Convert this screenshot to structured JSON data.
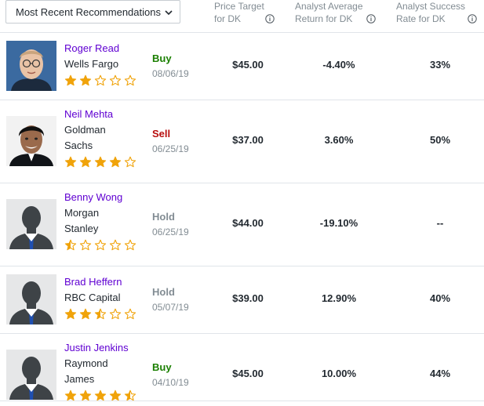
{
  "filter": {
    "selected": "Most Recent Recommendations"
  },
  "columns": {
    "price_target": [
      "Price Target",
      "for DK"
    ],
    "avg_return": [
      "Analyst Average",
      "Return for DK"
    ],
    "success_rate": [
      "Analyst Success",
      "Rate for DK"
    ]
  },
  "colors": {
    "buy": "#1a7f00",
    "sell": "#b80e0e",
    "hold": "#828c93",
    "star": "#f0a30a",
    "link": "#6001d2"
  },
  "analysts": [
    {
      "name": "Roger Read",
      "firm": [
        "Wells Fargo"
      ],
      "stars": 2,
      "rating": "Buy",
      "rating_type": "buy",
      "date": "08/06/19",
      "price_target": "$45.00",
      "avg_return": "-4.40%",
      "success_rate": "33%",
      "avatar": "photo-roger-read"
    },
    {
      "name": "Neil Mehta",
      "firm": [
        "Goldman",
        "Sachs"
      ],
      "stars": 4,
      "rating": "Sell",
      "rating_type": "sell",
      "date": "06/25/19",
      "price_target": "$37.00",
      "avg_return": "3.60%",
      "success_rate": "50%",
      "avatar": "photo-neil-mehta"
    },
    {
      "name": "Benny Wong",
      "firm": [
        "Morgan",
        "Stanley"
      ],
      "stars": 0.5,
      "rating": "Hold",
      "rating_type": "hold",
      "date": "06/25/19",
      "price_target": "$44.00",
      "avg_return": "-19.10%",
      "success_rate": "--",
      "avatar": "silhouette"
    },
    {
      "name": "Brad Heffern",
      "firm": [
        "RBC Capital"
      ],
      "stars": 2.5,
      "rating": "Hold",
      "rating_type": "hold",
      "date": "05/07/19",
      "price_target": "$39.00",
      "avg_return": "12.90%",
      "success_rate": "40%",
      "avatar": "silhouette"
    },
    {
      "name": "Justin Jenkins",
      "firm": [
        "Raymond",
        "James"
      ],
      "stars": 4.5,
      "rating": "Buy",
      "rating_type": "buy",
      "date": "04/10/19",
      "price_target": "$45.00",
      "avg_return": "10.00%",
      "success_rate": "44%",
      "avatar": "silhouette"
    }
  ]
}
